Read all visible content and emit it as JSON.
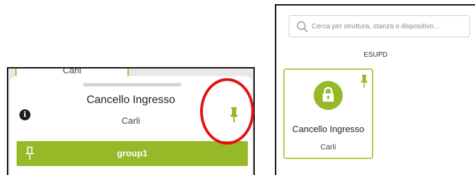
{
  "colors": {
    "accent": "#96b928",
    "highlight": "#e31212"
  },
  "left_panel": {
    "behind_card_label": "Carli",
    "sheet": {
      "title": "Cancello Ingresso",
      "subtitle": "Carli",
      "info_icon": "info-icon",
      "pin_icon": "pin-filled-icon",
      "group_button": {
        "icon": "pin-outline-icon",
        "label": "group1"
      }
    }
  },
  "right_panel": {
    "search": {
      "placeholder": "Cerca per struttura, stanza o dispositivo...",
      "value": ""
    },
    "group_heading": "ESUPD",
    "device_card": {
      "icon": "lock-icon",
      "pin_icon": "pin-filled-icon",
      "title": "Cancello Ingresso",
      "subtitle": "Carli"
    }
  }
}
